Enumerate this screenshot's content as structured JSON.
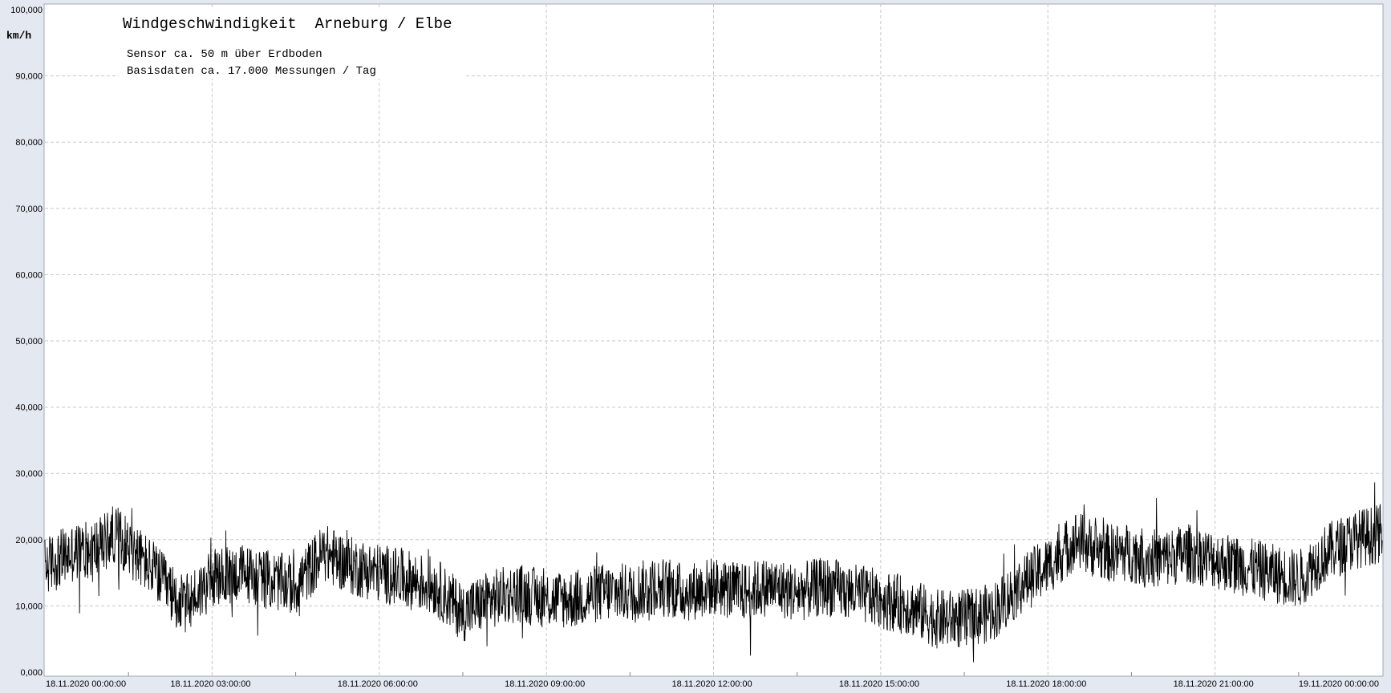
{
  "chart_data": {
    "type": "line",
    "title": "Windgeschwindigkeit  Arneburg / Elbe",
    "subtitle_lines": [
      "Sensor ca. 50 m über Erdboden",
      "Basisdaten ca. 17.000 Messungen / Tag"
    ],
    "ylabel": "km/h",
    "xlabel": "",
    "ylim": [
      0,
      100
    ],
    "xlim_hours": [
      0,
      24
    ],
    "y_ticks": [
      "0,000",
      "10,000",
      "20,000",
      "30,000",
      "40,000",
      "50,000",
      "60,000",
      "70,000",
      "80,000",
      "90,000",
      "100,000"
    ],
    "x_ticks": [
      "18.11.2020  00:00:00",
      "18.11.2020  03:00:00",
      "18.11.2020  06:00:00",
      "18.11.2020  09:00:00",
      "18.11.2020  12:00:00",
      "18.11.2020  15:00:00",
      "18.11.2020  18:00:00",
      "18.11.2020  21:00:00",
      "19.11.2020  00:00:00"
    ],
    "grid": true,
    "series": [
      {
        "color": "#000000",
        "x_hours": [
          0,
          0.5,
          1,
          1.25,
          1.5,
          2,
          2.25,
          2.5,
          3,
          3.5,
          4,
          4.5,
          5,
          5.5,
          6,
          6.5,
          7,
          7.5,
          8,
          8.5,
          9,
          9.5,
          10,
          10.5,
          11,
          11.5,
          12,
          12.5,
          13,
          13.5,
          14,
          14.5,
          15,
          15.5,
          16,
          16.5,
          17,
          17.5,
          18,
          18.5,
          19,
          19.5,
          20,
          20.5,
          21,
          21.5,
          22,
          22.5,
          23,
          23.5,
          24
        ],
        "values": [
          16,
          18,
          19,
          21,
          19,
          15,
          12,
          10,
          14,
          15,
          14,
          13,
          18,
          16,
          15,
          14,
          13,
          9,
          11,
          12,
          11,
          11,
          12,
          12,
          13,
          12,
          13,
          12,
          13,
          12,
          13,
          12,
          11,
          10,
          8,
          8,
          9,
          13,
          16,
          20,
          18,
          18,
          17,
          18,
          17,
          16,
          15,
          14,
          18,
          20,
          21
        ],
        "noise_amplitude": 4.5,
        "max_value": 29.5,
        "min_value": 1.5
      }
    ]
  }
}
